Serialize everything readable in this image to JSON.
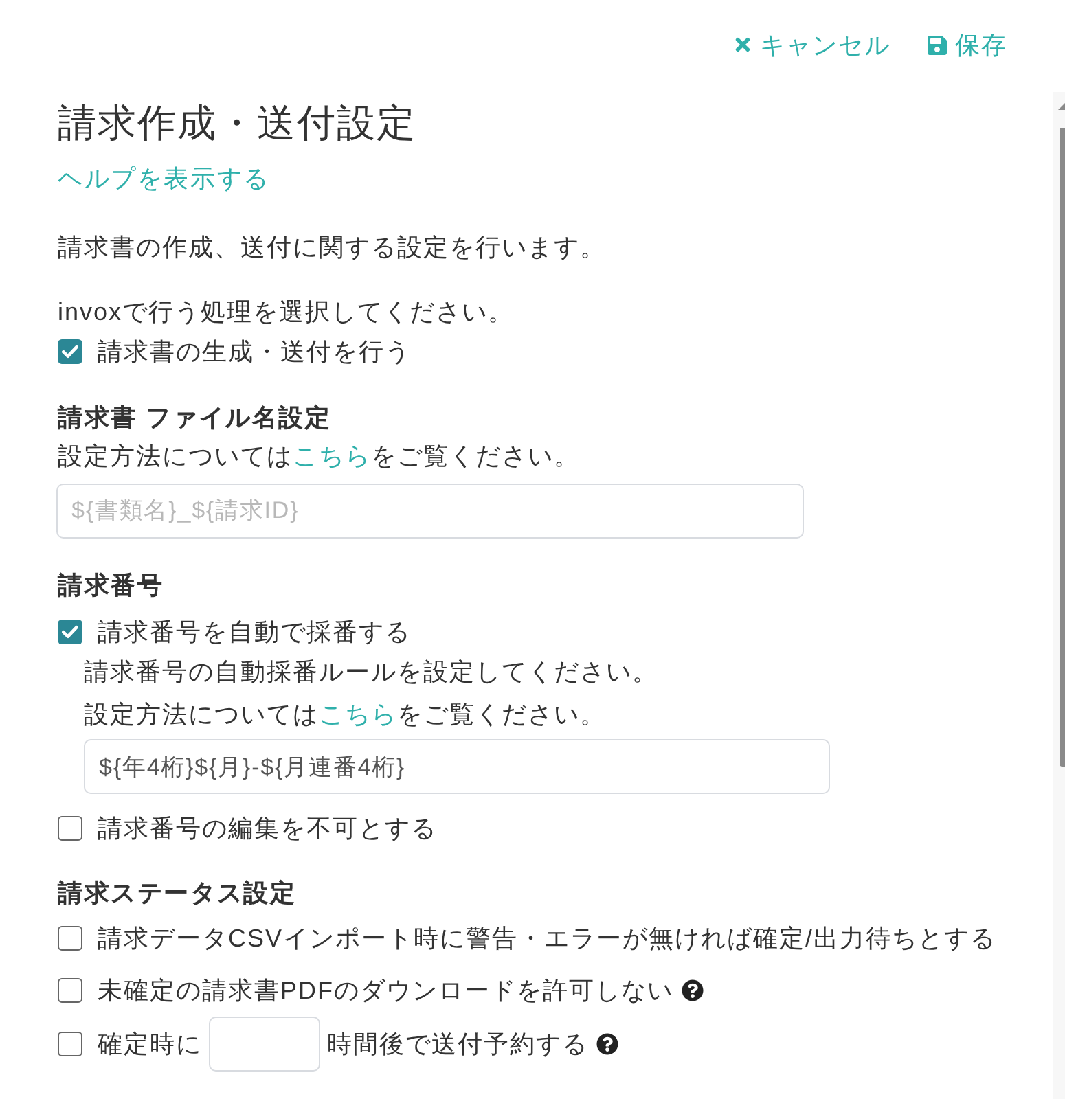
{
  "toolbar": {
    "cancel": "キャンセル",
    "save": "保存"
  },
  "title": "請求作成・送付設定",
  "help_link": "ヘルプを表示する",
  "description": "請求書の作成、送付に関する設定を行います。",
  "processing": {
    "prompt": "invoxで行う処理を選択してください。",
    "options": [
      {
        "label": "請求書の生成・送付を行う",
        "checked": true
      }
    ]
  },
  "file_name": {
    "heading": "請求書 ファイル名設定",
    "hint": {
      "before": "設定方法については",
      "link": "こちら",
      "after": "をご覧ください。"
    },
    "field": {
      "placeholder": "${書類名}_${請求ID}"
    }
  },
  "invoice_number": {
    "heading": "請求番号",
    "auto": {
      "label": "請求番号を自動で採番する",
      "checked": true,
      "note": "請求番号の自動採番ルールを設定してください。",
      "hint": {
        "before": "設定方法については",
        "link": "こちら",
        "after": "をご覧ください。"
      },
      "field": {
        "value": "${年4桁}${月}-${月連番4桁}"
      }
    },
    "lock": {
      "label": "請求番号の編集を不可とする",
      "checked": false
    }
  },
  "status": {
    "heading": "請求ステータス設定",
    "options": [
      {
        "kind": "plain",
        "label": "請求データCSVインポート時に警告・エラーが無ければ確定/出力待ちとする",
        "checked": false,
        "help": false
      },
      {
        "kind": "plain",
        "label": "未確定の請求書PDFのダウンロードを許可しない",
        "checked": false,
        "help": true
      },
      {
        "kind": "hours",
        "label_before": "確定時に",
        "label_after": "時間後で送付予約する",
        "checked": false,
        "help": true
      }
    ]
  }
}
